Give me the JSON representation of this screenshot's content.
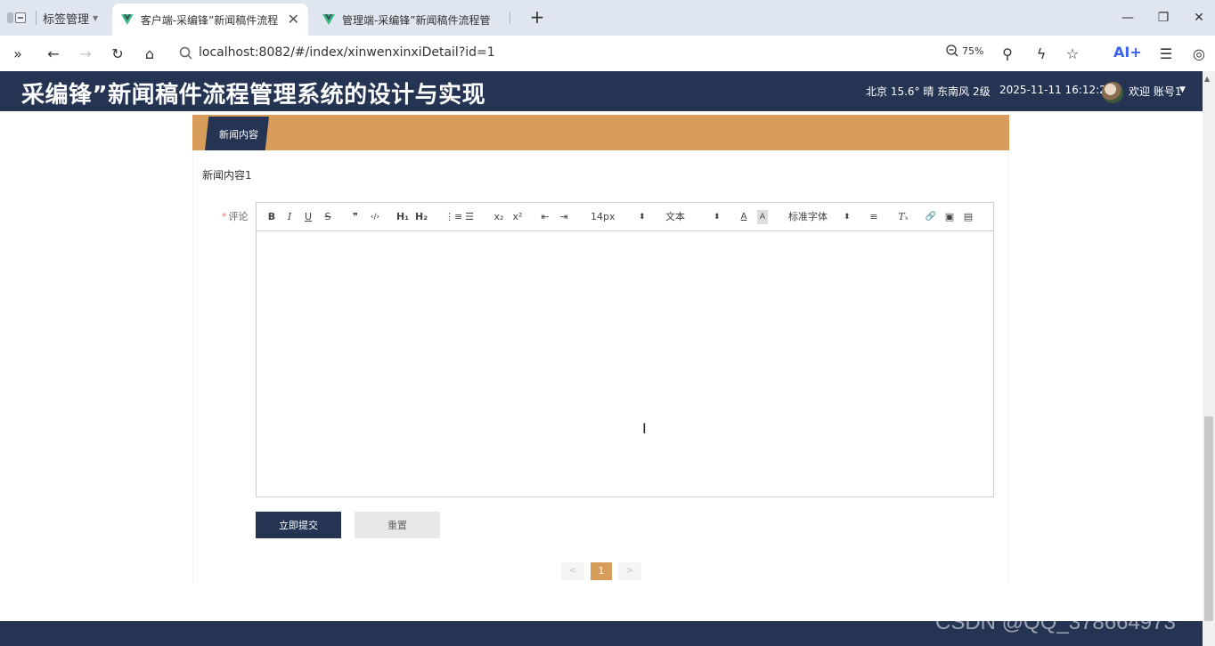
{
  "browser": {
    "tab_group_label": "标签管理",
    "tabs": [
      {
        "title": "客户端-采编锋”新闻稿件流程",
        "active": true
      },
      {
        "title": "管理端-采编锋”新闻稿件流程管",
        "active": false
      }
    ],
    "url": "localhost:8082/#/index/xinwenxinxiDetail?id=1",
    "zoom": "75%",
    "ai_label": "AI+"
  },
  "header": {
    "title": "采编锋”新闻稿件流程管理系统的设计与实现",
    "weather": "北京  15.6°  晴  东南风  2级",
    "datetime": "2025-11-11 16:12:29",
    "welcome": "欢迎 账号1"
  },
  "section": {
    "tab_label": "新闻内容",
    "content": "新闻内容1"
  },
  "form": {
    "comment_label": "评论",
    "required_mark": "*",
    "toolbar": {
      "bold": "B",
      "italic": "I",
      "underline": "U",
      "strike": "S",
      "quote": "❞",
      "code": "‹/›",
      "h1": "H₁",
      "h2": "H₂",
      "ordered_list": "⋮≡",
      "bullet_list": "☰",
      "subscript": "x₂",
      "superscript": "x²",
      "outdent": "⇤",
      "indent": "⇥",
      "size": "14px",
      "header": "文本",
      "color": "A",
      "background": "A",
      "font": "标准字体",
      "align": "≡",
      "clean": "Tₓ",
      "link": "🔗",
      "image": "▣",
      "video": "▤"
    },
    "submit_label": "立即提交",
    "reset_label": "重置"
  },
  "pagination": {
    "prev": "<",
    "current": "1",
    "next": ">"
  },
  "watermark": "CSDN @QQ_378664973"
}
